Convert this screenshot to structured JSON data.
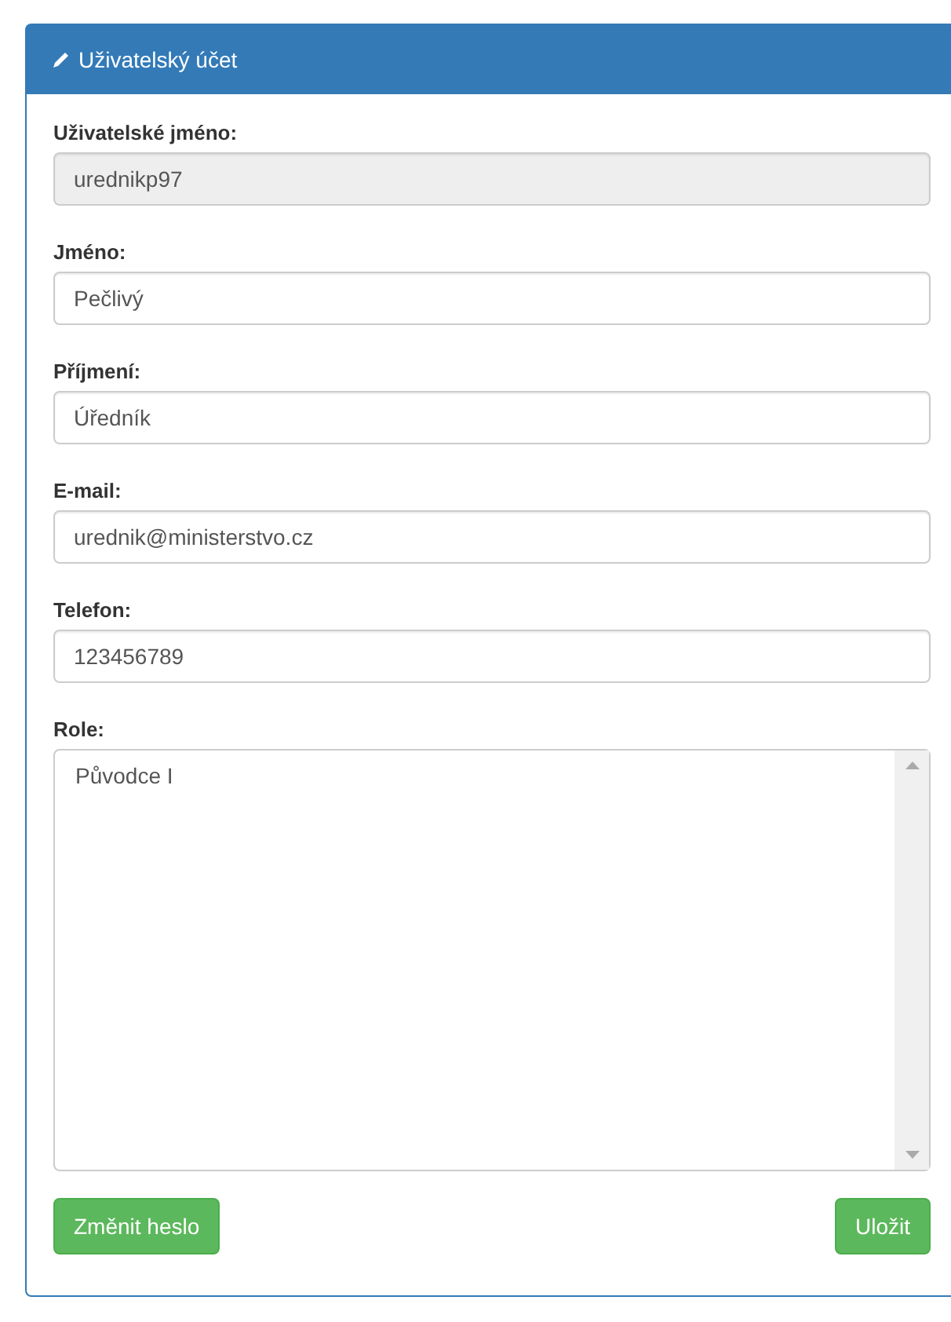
{
  "panel": {
    "title": "Uživatelský účet"
  },
  "fields": [
    {
      "label": "Uživatelské jméno:",
      "value": "urednikp97",
      "disabled": true
    },
    {
      "label": "Jméno:",
      "value": "Pečlivý",
      "disabled": false
    },
    {
      "label": "Příjmení:",
      "value": "Úředník",
      "disabled": false
    },
    {
      "label": "E-mail:",
      "value": "urednik@ministerstvo.cz",
      "disabled": false
    },
    {
      "label": "Telefon:",
      "value": "123456789",
      "disabled": false
    }
  ],
  "roles": {
    "label": "Role:",
    "items": [
      "Původce I"
    ]
  },
  "buttons": [
    {
      "label": "Změnit heslo",
      "kind": "left"
    },
    {
      "label": "Uložit",
      "kind": "right"
    }
  ]
}
